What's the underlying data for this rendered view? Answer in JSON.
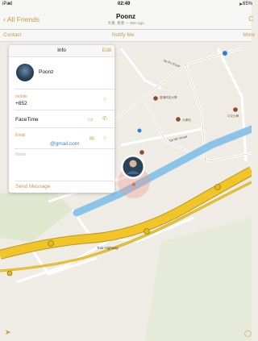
{
  "status": {
    "carrier": "iPad",
    "time": "02:49",
    "battery": "65%"
  },
  "nav": {
    "back_label": "All Friends",
    "title": "Poonz",
    "subtitle": "大東, 香港 — 30m ago",
    "right_glyph": "C"
  },
  "toolbar": {
    "contact": "Contact",
    "notify": "Notify Me",
    "more": "More"
  },
  "info": {
    "title": "Info",
    "edit": "Edit",
    "name": "Poonz",
    "mobile_label": "mobile",
    "mobile_value": "+852",
    "facetime_label": "FaceTime",
    "email_label": "Email",
    "email_value": "@gmail.com",
    "notes_label": "Notes",
    "send_message": "Send Message"
  },
  "map": {
    "roads": [
      "Tai Po Road",
      "Tolo Highway",
      "Tai Wo Road"
    ],
    "places": [
      "香港科技大學",
      "大學站",
      "中文大學"
    ],
    "water_color": "#8cc4e8",
    "highway_color": "#f1c528",
    "accent_color": "#c79a45"
  },
  "icons": {
    "location": "location-arrow-icon",
    "back": "chevron-left-icon"
  }
}
